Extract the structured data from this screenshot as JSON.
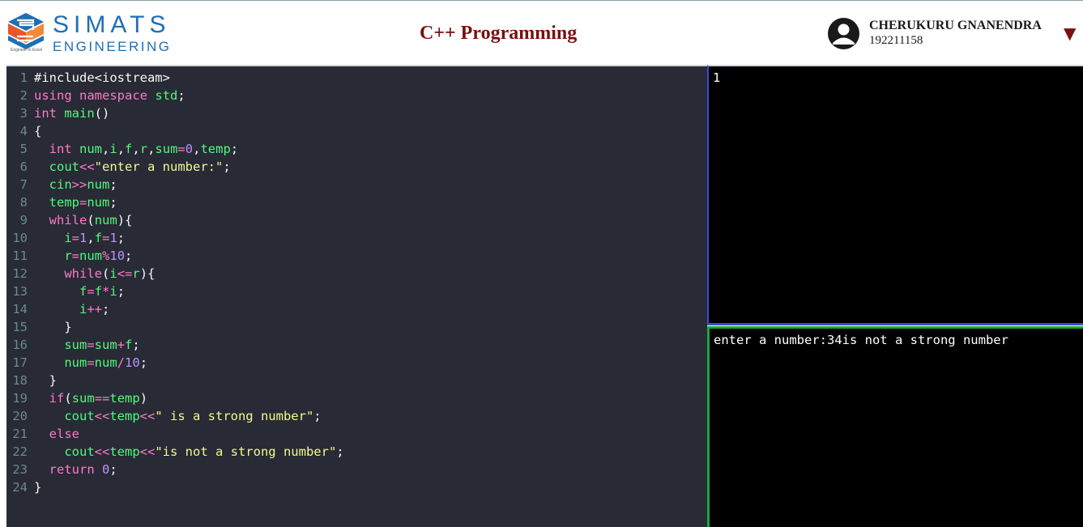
{
  "header": {
    "brand_name": "SIMATS",
    "brand_sub": "ENGINEERING",
    "brand_tagline": "Engineer to Excel",
    "page_title": "C++ Programming",
    "user_name": "CHERUKURU GNANENDRA",
    "user_id": "192211158",
    "menu_caret": "▼",
    "colors": {
      "brand": "#1d6fb8",
      "title": "#7a1010"
    }
  },
  "editor": {
    "theme": "dracula",
    "lines": [
      "#include<iostream>",
      "using namespace std;",
      "int main()",
      "{",
      "  int num,i,f,r,sum=0,temp;",
      "  cout<<\"enter a number:\";",
      "  cin>>num;",
      "  temp=num;",
      "  while(num){",
      "    i=1,f=1;",
      "    r=num%10;",
      "    while(i<=r){",
      "      f=f*i;",
      "      i++;",
      "    }",
      "    sum=sum+f;",
      "    num=num/10;",
      "  }",
      "  if(sum==temp)",
      "    cout<<temp<<\" is a strong number\";",
      "  else",
      "    cout<<temp<<\"is not a strong number\";",
      "  return 0;",
      "}"
    ]
  },
  "input_panel": {
    "text": "1"
  },
  "output_panel": {
    "text": "enter a number:34is not a strong number"
  }
}
